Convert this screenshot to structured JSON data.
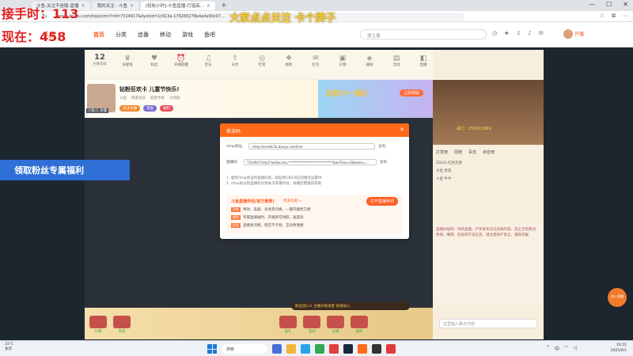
{
  "browser": {
    "tabs": [
      {
        "label": "斗鱼-关注不迷路-直播",
        "active": false
      },
      {
        "label": "我的关注 - 斗鱼",
        "active": false
      },
      {
        "label": "[轻松小时]-斗鱼直播-打造高...",
        "active": true
      }
    ],
    "new_tab": "+",
    "window_controls": [
      "—",
      "☐",
      "✕"
    ],
    "url": "www.douyu.com/topic/mir?rid=7314917&dyshid=1c613a-179260278e4ada60c07..."
  },
  "site": {
    "logo": "斗鱼",
    "nav": [
      {
        "label": "首页",
        "current": true
      },
      {
        "label": "分类"
      },
      {
        "label": "追番"
      },
      {
        "label": "移动"
      },
      {
        "label": "游戏"
      },
      {
        "label": "鱼吧"
      }
    ],
    "search_placeholder": "搜主播",
    "live_button": "开播"
  },
  "overlay": {
    "line1": "接手时：113",
    "line2": "现在：458",
    "top_banner": "大家点点关注 卡个牌子",
    "fan_banner": "领取粉丝专属福利"
  },
  "room": {
    "level": "12",
    "level_label": "主播等级",
    "gift_items": [
      "贡献值",
      "粉丝",
      "开播提醒",
      "音乐",
      "分享",
      "打赏",
      "福利",
      "红包",
      "礼物",
      "通知",
      "活动",
      "直播"
    ],
    "anchor_title": "钻粉狂欢卡 儿童节快乐!",
    "anchor_sub": [
      "斗鱼",
      "网游竞技",
      "超星传奇",
      "大地图"
    ],
    "anchor_avatar_tag": "小鱼儿 主播",
    "pills": [
      "关注主播",
      "贵族",
      "福利"
    ],
    "banner_title": "钻粉六一福礼",
    "banner_button": "立即领取",
    "sidepanel_score": "战力：250013669",
    "sidepanel_tabs": [
      "打赏榜",
      "周榜",
      "贵宾",
      "亲密榜"
    ],
    "sidepanel_rows": [
      "ZDGQ 红色至尊",
      "大鱼 贵宾",
      "十里 牛牛"
    ],
    "chat_text": "直播间规则：绿色直播，严禁发布违法违规内容，禁止涉及政治、色情、赌博、低俗等不良信息，请注意财产安全，谨防诈骗",
    "chat_input_placeholder": "这里输入聊天内容",
    "bottom_items": [
      "礼物",
      "贵族",
      "送礼",
      "活动",
      "主播",
      "抽奖"
    ],
    "chat_bubble": "粉丝团Lv1 主播升级进度 快来加入"
  },
  "modal": {
    "title": "推流码",
    "close": "✕",
    "server_label": "rtmp地址：",
    "server_value": "rtmp://sendtc3a.douyu.com/live",
    "stream_label": "直播码：",
    "stream_value": "7314917rrHy5?wsSecret=****************************&wsTime=6&token=...",
    "copy": "复制",
    "notes": [
      "1. 复制rtmp地址和直播码后，粘贴到OBS对应的推流设置中",
      "2. rtmp地址和直播码仅限本次开播有效，关播后需重新获取"
    ],
    "promo_title": "斗鱼直播伴侣(官方推荐)",
    "promo_link": "更多功能 >",
    "promo_button": "打开直播伴侣",
    "promo_lines": [
      {
        "tag": "功能",
        "text": "特效、美颜、多场景切换，一键开播更方便"
      },
      {
        "tag": "福利",
        "text": "专属直播福利，开播即可领取，速度快"
      },
      {
        "tag": "优势",
        "text": "直播更流畅，稳定不卡顿，互动更便捷"
      }
    ]
  },
  "fab": "进入直播",
  "taskbar": {
    "weather_temp": "31°C",
    "weather_desc": "多云",
    "search": "搜索",
    "clock_time": "16:55",
    "clock_date": "2025/6/1"
  }
}
